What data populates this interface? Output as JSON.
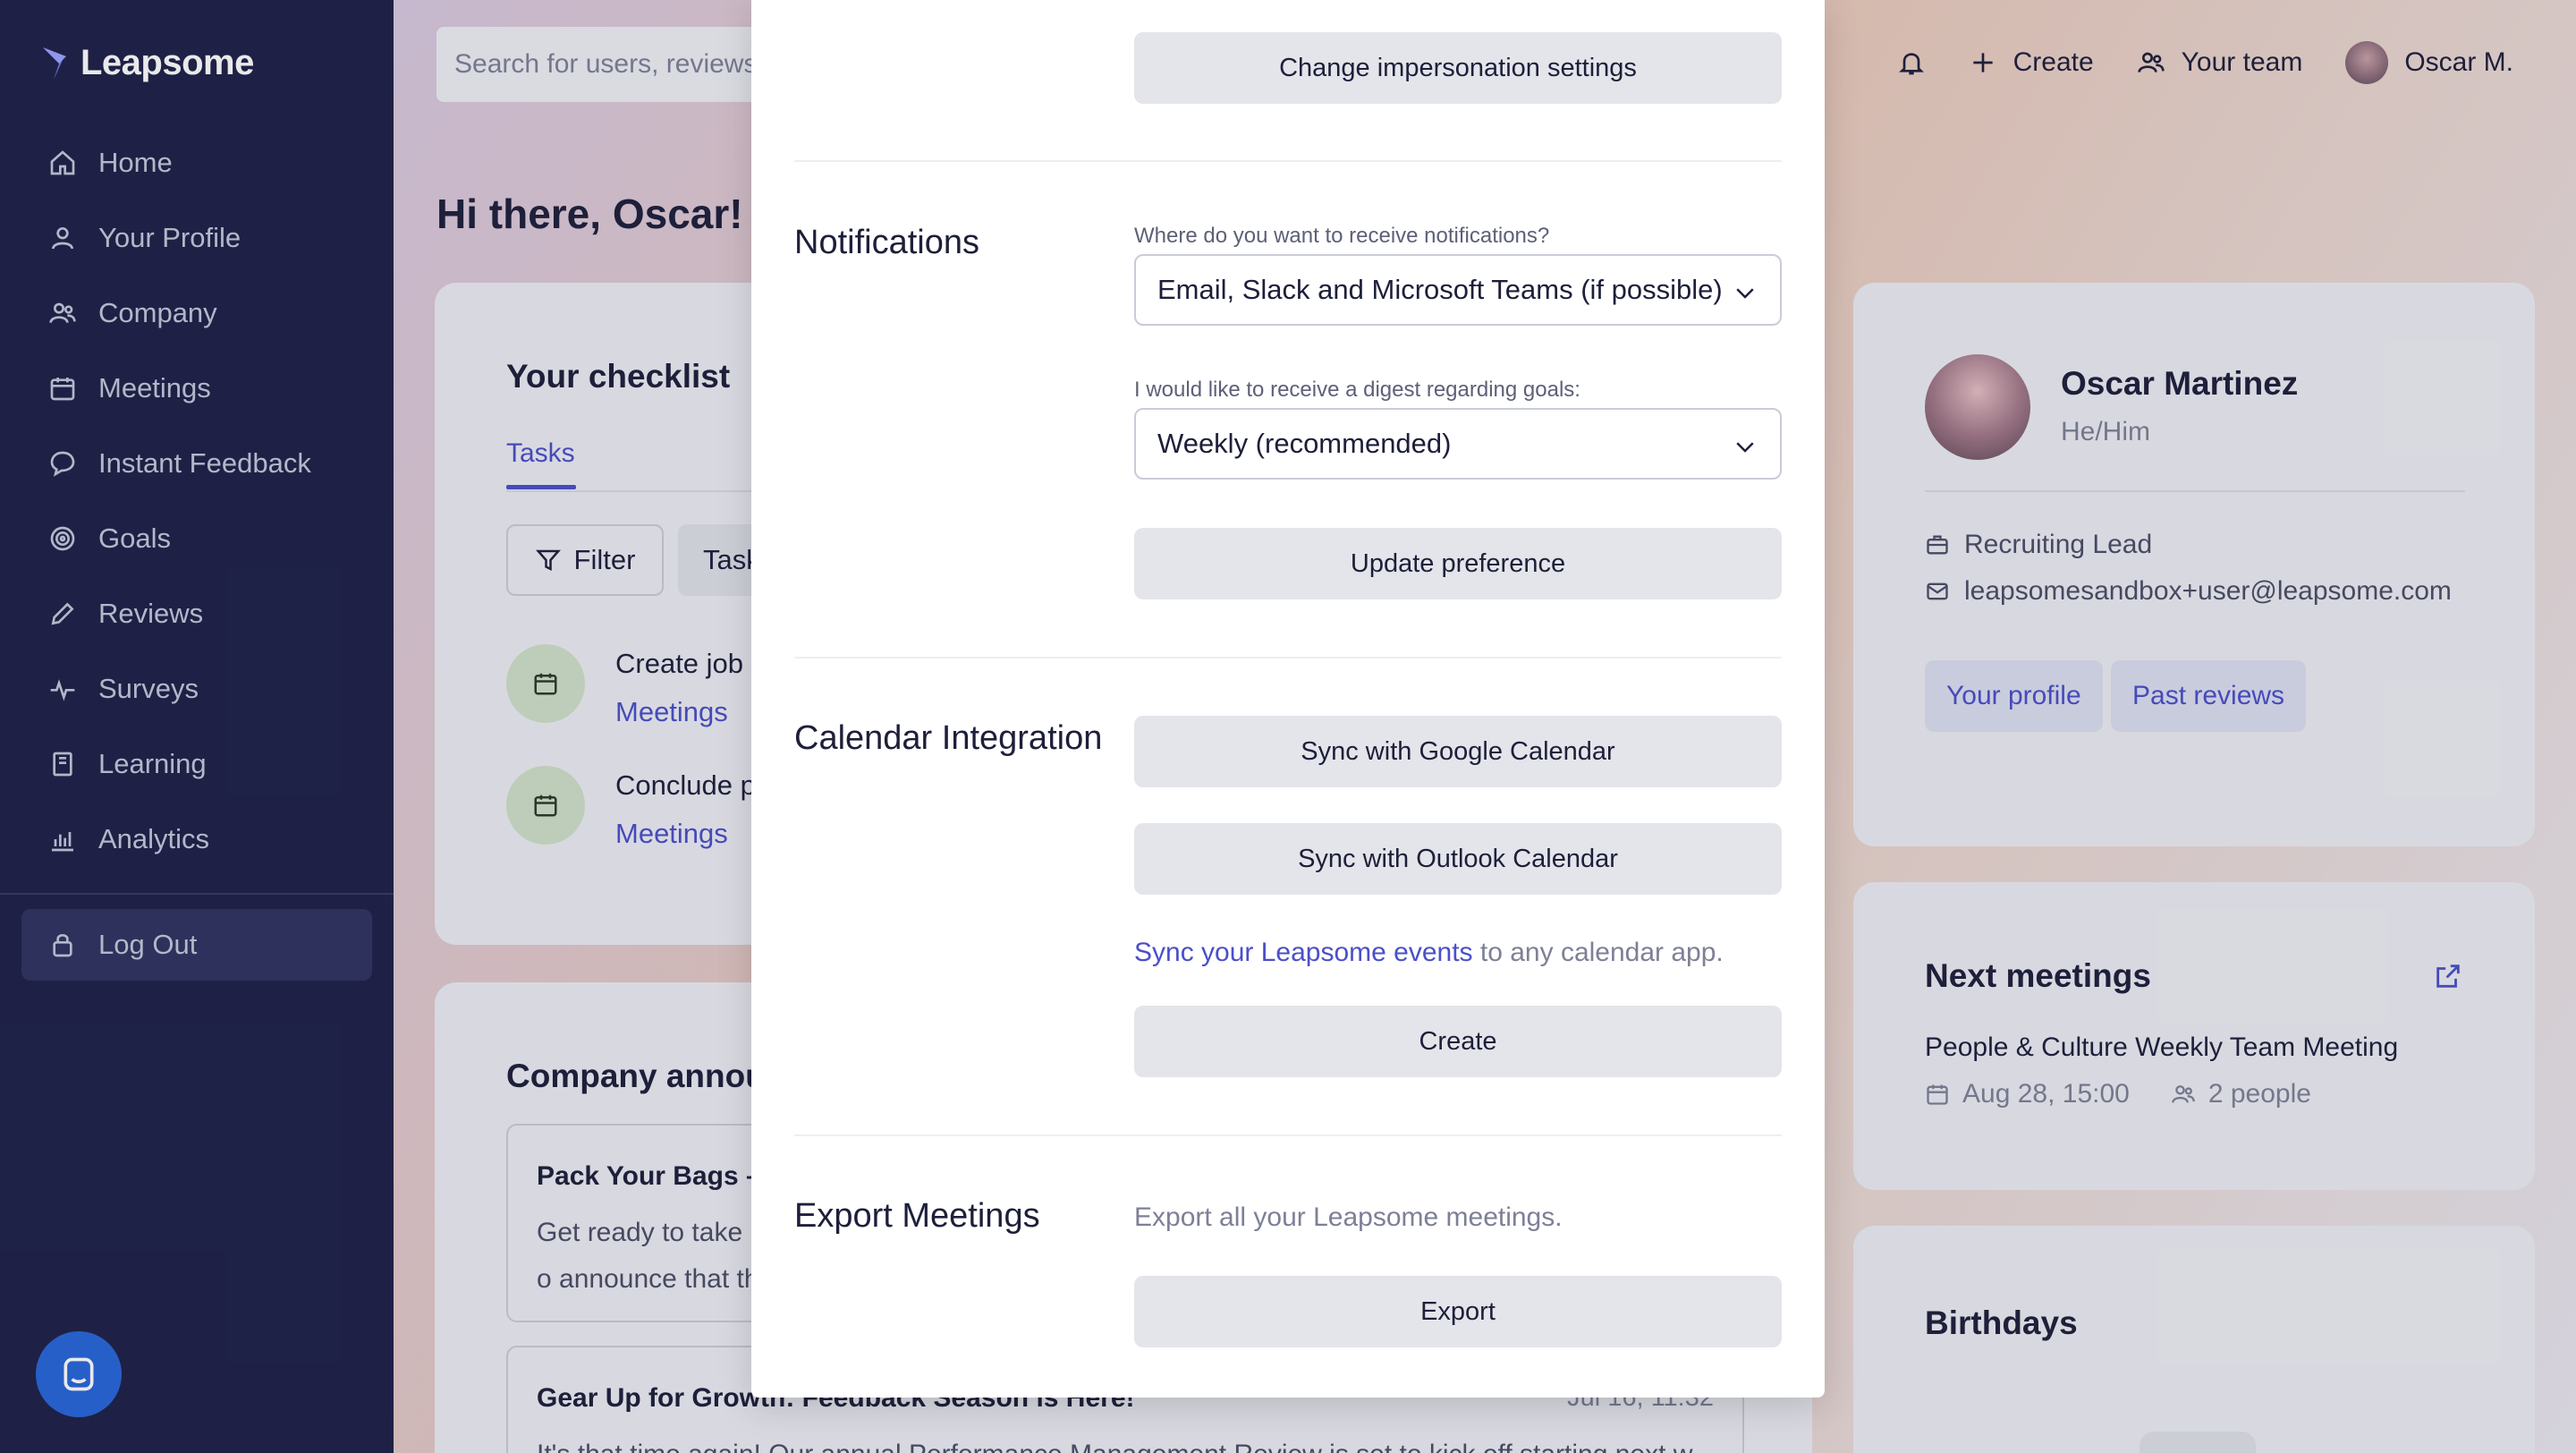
{
  "sidebar": {
    "logo": "Leapsome",
    "items": [
      {
        "label": "Home",
        "icon": "home-icon"
      },
      {
        "label": "Your Profile",
        "icon": "user-icon"
      },
      {
        "label": "Company",
        "icon": "users-icon"
      },
      {
        "label": "Meetings",
        "icon": "calendar-icon"
      },
      {
        "label": "Instant Feedback",
        "icon": "chat-icon"
      },
      {
        "label": "Goals",
        "icon": "target-icon"
      },
      {
        "label": "Reviews",
        "icon": "pencil-icon"
      },
      {
        "label": "Surveys",
        "icon": "pulse-icon"
      },
      {
        "label": "Learning",
        "icon": "book-icon"
      },
      {
        "label": "Analytics",
        "icon": "chart-icon"
      }
    ],
    "logout": "Log Out"
  },
  "topbar": {
    "search_placeholder": "Search for users, reviews",
    "create": "Create",
    "your_team": "Your team",
    "user_name": "Oscar M."
  },
  "greeting": "Hi there, Oscar!",
  "checklist": {
    "title": "Your checklist",
    "tab": "Tasks",
    "filter": "Filter",
    "tasks_btn": "Task",
    "tasks": [
      {
        "title": "Create job l",
        "category": "Meetings"
      },
      {
        "title": "Conclude p",
        "category": "Meetings"
      }
    ]
  },
  "announcements": {
    "title": "Company annou",
    "items": [
      {
        "title": "Pack Your Bags –",
        "date": "",
        "line1": "Get ready to take",
        "line2": "o announce that th"
      },
      {
        "title": "Gear Up for Growth: Feedback Season is Here!",
        "date": "Jul 16, 11:32",
        "line1": "It's that time again! Our annual Performance Management Review is set to kick off starting next w",
        "line2": ""
      }
    ]
  },
  "profile": {
    "name": "Oscar Martinez",
    "pronouns": "He/Him",
    "role": "Recruiting Lead",
    "email": "leapsomesandbox+user@leapsome.com",
    "btn_profile": "Your profile",
    "btn_reviews": "Past reviews"
  },
  "meetings": {
    "title": "Next meetings",
    "meeting_name": "People & Culture Weekly Team Meeting",
    "date": "Aug 28, 15:00",
    "people": "2 people"
  },
  "birthdays": {
    "title": "Birthdays"
  },
  "modal": {
    "impersonation_btn": "Change impersonation settings",
    "notifications_heading": "Notifications",
    "notif_label": "Where do you want to receive notifications?",
    "notif_value": "Email, Slack and Microsoft Teams (if possible)",
    "digest_label": "I would like to receive a digest regarding goals:",
    "digest_value": "Weekly (recommended)",
    "update_btn": "Update preference",
    "calendar_heading": "Calendar Integration",
    "google_btn": "Sync with Google Calendar",
    "outlook_btn": "Sync with Outlook Calendar",
    "sync_link": "Sync your Leapsome events",
    "sync_rest": " to any calendar app.",
    "create_btn": "Create",
    "export_heading": "Export Meetings",
    "export_text": "Export all your Leapsome meetings.",
    "export_btn": "Export"
  },
  "colors": {
    "sidebar": "#1d2147",
    "accent": "#4a4fc9",
    "chat_button": "#2866d9"
  }
}
